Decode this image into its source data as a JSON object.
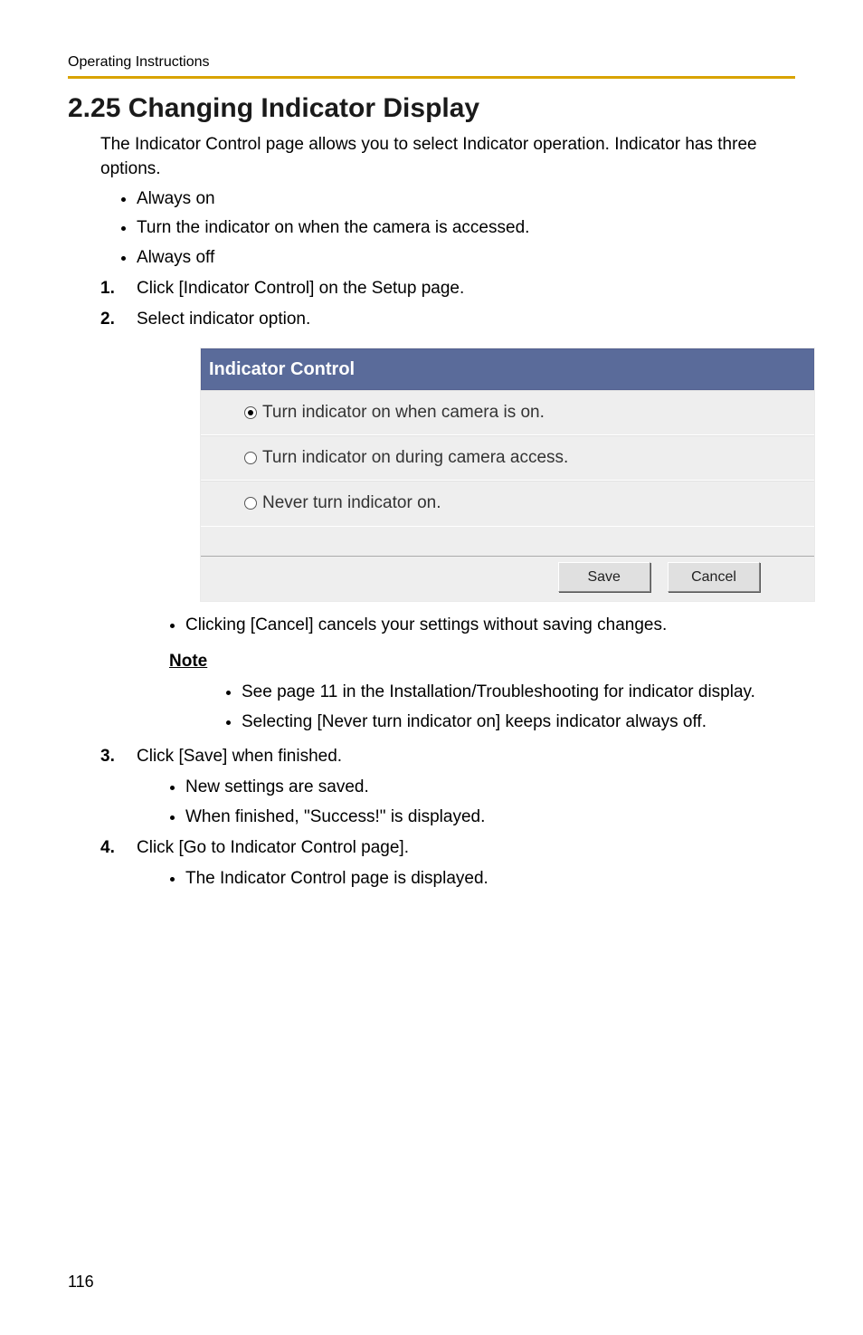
{
  "header": {
    "label": "Operating Instructions"
  },
  "title": "2.25  Changing Indicator Display",
  "intro": "The Indicator Control page allows you to select Indicator operation. Indicator has three options.",
  "options": [
    "Always on",
    "Turn the indicator on when the camera is accessed.",
    "Always off"
  ],
  "steps": {
    "s1": {
      "num": "1.",
      "text": "Click [Indicator Control] on the Setup page."
    },
    "s2": {
      "num": "2.",
      "text": "Select indicator option.",
      "screenshot": {
        "title": "Indicator Control",
        "radios": [
          {
            "label": "Turn indicator on when camera is on.",
            "checked": true
          },
          {
            "label": "Turn indicator on during camera access.",
            "checked": false
          },
          {
            "label": "Never turn indicator on.",
            "checked": false
          }
        ],
        "save_label": "Save",
        "cancel_label": "Cancel"
      },
      "after_bullet": "Clicking [Cancel] cancels your settings without saving changes.",
      "note_label": "Note",
      "note_bullets": [
        "See page 11 in the Installation/Troubleshooting for indicator display.",
        "Selecting [Never turn indicator on] keeps indicator always off."
      ]
    },
    "s3": {
      "num": "3.",
      "text": "Click [Save] when finished.",
      "bullets": [
        "New settings are saved.",
        "When finished, \"Success!\" is displayed."
      ]
    },
    "s4": {
      "num": "4.",
      "text": "Click [Go to Indicator Control page].",
      "bullets": [
        "The Indicator Control page is displayed."
      ]
    }
  },
  "page_number": "116"
}
